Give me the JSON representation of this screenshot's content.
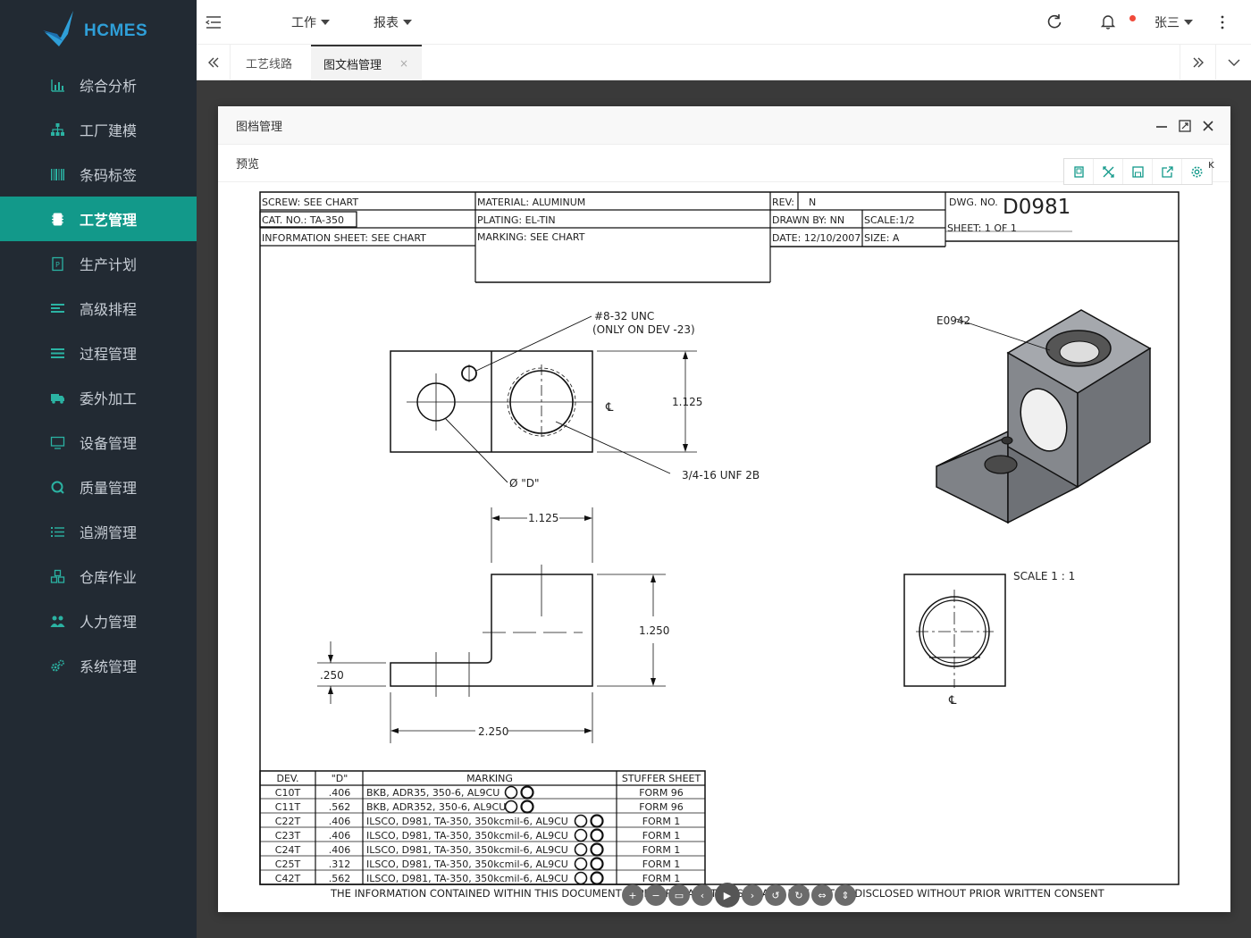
{
  "brand": {
    "logo_text": "HCMES"
  },
  "sidebar": {
    "items": [
      {
        "label": "综合分析",
        "icon": "bar-chart-icon"
      },
      {
        "label": "工厂建模",
        "icon": "sitemap-icon"
      },
      {
        "label": "条码标签",
        "icon": "barcode-icon"
      },
      {
        "label": "工艺管理",
        "icon": "chip-icon",
        "active": true
      },
      {
        "label": "生产计划",
        "icon": "document-icon"
      },
      {
        "label": "高级排程",
        "icon": "schedule-icon"
      },
      {
        "label": "过程管理",
        "icon": "list-icon"
      },
      {
        "label": "委外加工",
        "icon": "truck-icon"
      },
      {
        "label": "设备管理",
        "icon": "monitor-icon"
      },
      {
        "label": "质量管理",
        "icon": "quality-icon"
      },
      {
        "label": "追溯管理",
        "icon": "ordered-list-icon"
      },
      {
        "label": "仓库作业",
        "icon": "cubes-icon"
      },
      {
        "label": "人力管理",
        "icon": "users-icon"
      },
      {
        "label": "系统管理",
        "icon": "gears-icon"
      }
    ],
    "active_color": "#12998a",
    "bg_color": "#222a33"
  },
  "header": {
    "nav": [
      {
        "label": "工作"
      },
      {
        "label": "报表"
      }
    ],
    "user_name": "张三",
    "notification_dot_color": "#f04a3a"
  },
  "tabs": [
    {
      "label": "工艺线路"
    },
    {
      "label": "图文档管理",
      "active": true,
      "close": "×"
    }
  ],
  "dialog": {
    "title": "图档管理",
    "subtitle": "预览",
    "x_fragment": "ĸ"
  },
  "drawing": {
    "title_block": {
      "screw": "SCREW:  SEE CHART",
      "cat_no": "CAT. NO.: TA-350",
      "info_sheet": "INFORMATION SHEET: SEE CHART",
      "material": "MATERIAL: ALUMINUM",
      "plating": "PLATING:   EL-TIN",
      "marking": "MARKING:  SEE CHART",
      "rev_label": "REV:",
      "rev_value": "N",
      "drawn_by": "DRAWN BY: NN",
      "scale": "SCALE:1/2",
      "date": "DATE: 12/10/2007",
      "size": "SIZE:  A",
      "dwg_label": "DWG. NO.",
      "dwg_no": "D0981",
      "sheet": "SHEET:  1 OF 1"
    },
    "annotations": {
      "thread_small": "#8-32 UNC",
      "thread_small_note": "(ONLY ON DEV -23)",
      "centerline": "℄",
      "dim_1125_v": "1.125",
      "thread_large": "3/4-16 UNF 2B",
      "dia_d": "Ø \"D\"",
      "dim_1125_h": "1.125",
      "dim_1250": "1.250",
      "dim_250": ".250",
      "dim_2250": "2.250",
      "part_ref": "E0942",
      "scale_label": "SCALE 1 : 1",
      "footer": "THE INFORMATION CONTAINED WITHIN THIS DOCUMENT IS PROPRIETARY TO ILSCO AND MAY NOT BE DISCLOSED WITHOUT PRIOR WRITTEN CONSENT"
    },
    "table": {
      "headers": [
        "DEV.",
        "\"D\"",
        "MARKING",
        "STUFFER SHEET"
      ],
      "rows": [
        [
          "C10T",
          ".406",
          "BKB, ADR35, 350-6, AL9CU",
          "FORM 96"
        ],
        [
          "C11T",
          ".562",
          "BKB, ADR352, 350-6, AL9CU",
          "FORM 96"
        ],
        [
          "C22T",
          ".406",
          "ILSCO, D981, TA-350, 350kcmil-6, AL9CU",
          "FORM 1"
        ],
        [
          "C23T",
          ".406",
          "ILSCO, D981, TA-350, 350kcmil-6, AL9CU",
          "FORM 1"
        ],
        [
          "C24T",
          ".406",
          "ILSCO, D981, TA-350, 350kcmil-6, AL9CU",
          "FORM 1"
        ],
        [
          "C25T",
          ".312",
          "ILSCO, D981, TA-350, 350kcmil-6, AL9CU",
          "FORM 1"
        ],
        [
          "C42T",
          ".562",
          "ILSCO, D981, TA-350, 350kcmil-6, AL9CU",
          "FORM 1"
        ]
      ]
    }
  }
}
